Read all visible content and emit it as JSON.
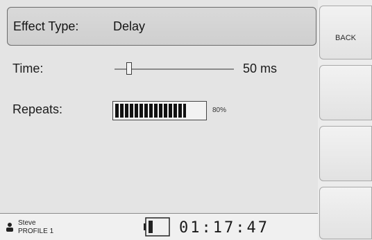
{
  "effect": {
    "type_label": "Effect Type:",
    "type_value": "Delay"
  },
  "params": {
    "time": {
      "label": "Time:",
      "value_text": "50 ms",
      "slider_level": 0.1
    },
    "repeats": {
      "label": "Repeats:",
      "percent_text": "80%",
      "level": 0.8
    }
  },
  "softkeys": [
    {
      "label": "BACK"
    },
    {
      "label": ""
    },
    {
      "label": ""
    },
    {
      "label": ""
    }
  ],
  "status": {
    "user": "Steve",
    "profile": "PROFILE 1",
    "time": "01:17:47",
    "user_icon": "user-icon",
    "battery_icon": "battery-icon"
  },
  "colors": {
    "background": "#e4e4e4",
    "header_bg": "#d4d4d4",
    "progress_fill": "#111111"
  }
}
